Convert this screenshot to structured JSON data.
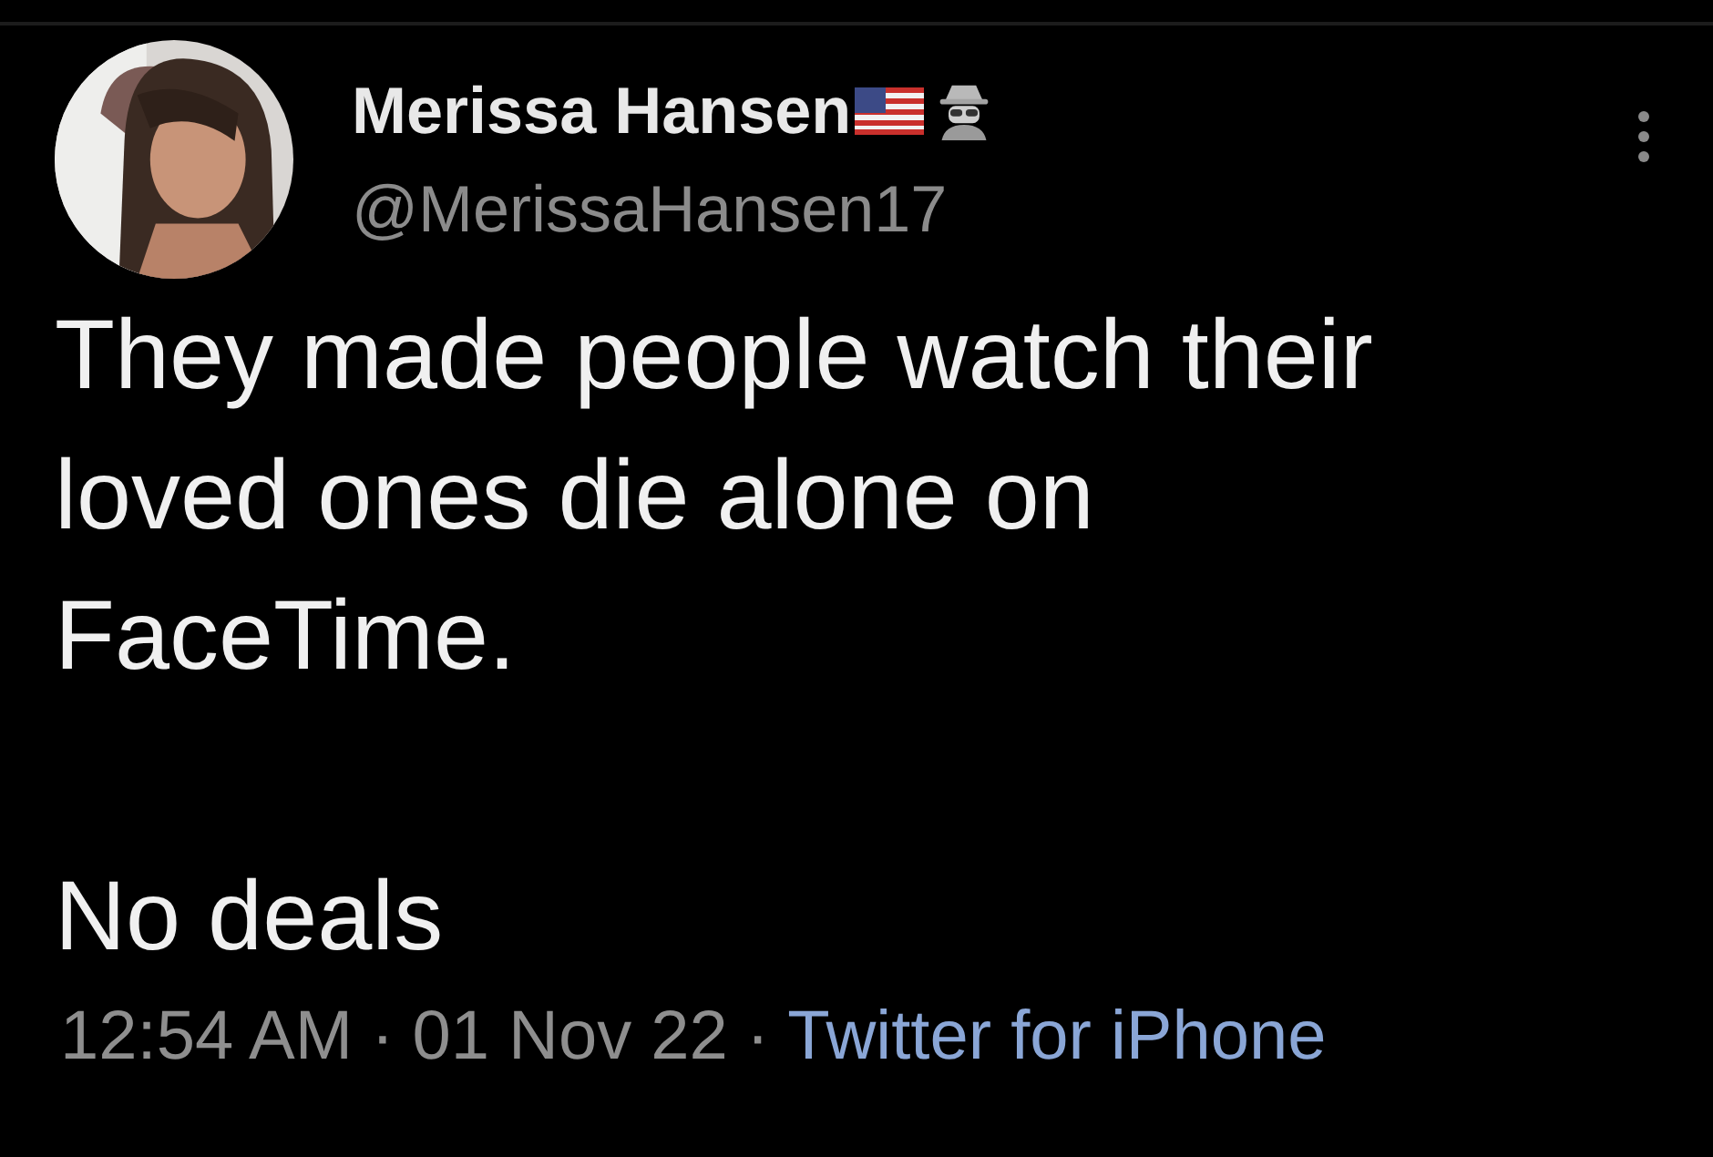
{
  "author": {
    "name": "Merissa Hansen",
    "handle": "@MerissaHansen17"
  },
  "body": [
    "They made people watch their loved ones die alone on FaceTime.",
    "No deals"
  ],
  "meta": {
    "time": "12:54 AM",
    "separator_1": "·",
    "date": "01 Nov 22",
    "separator_2": "·",
    "source": "Twitter for iPhone"
  }
}
